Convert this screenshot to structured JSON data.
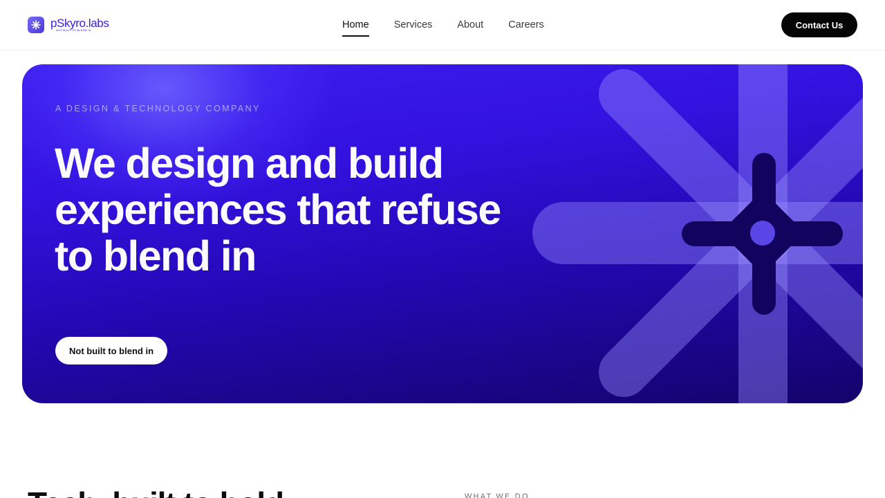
{
  "brand": {
    "name": "pSkyro.labs",
    "tagline": "NOT BUILT TO BLEND IN",
    "logo_icon": "asterisk-logo-icon",
    "accent_color": "#3b22d6"
  },
  "nav": {
    "items": [
      {
        "label": "Home",
        "active": true
      },
      {
        "label": "Services",
        "active": false
      },
      {
        "label": "About",
        "active": false
      },
      {
        "label": "Careers",
        "active": false
      }
    ],
    "cta_label": "Contact Us"
  },
  "hero": {
    "eyebrow": "A DESIGN & TECHNOLOGY COMPANY",
    "headline": "We design and build experiences that refuse to blend in",
    "button_label": "Not built to blend in",
    "graphic_icon": "asterisk-emblem-icon",
    "colors": {
      "gradient_top": "#3d1ef0",
      "gradient_bottom": "#14036b",
      "emblem_dark": "#12035e"
    }
  },
  "next_section": {
    "title_partial": "Tech, built to hold",
    "eyebrow": "WHAT WE DO"
  }
}
